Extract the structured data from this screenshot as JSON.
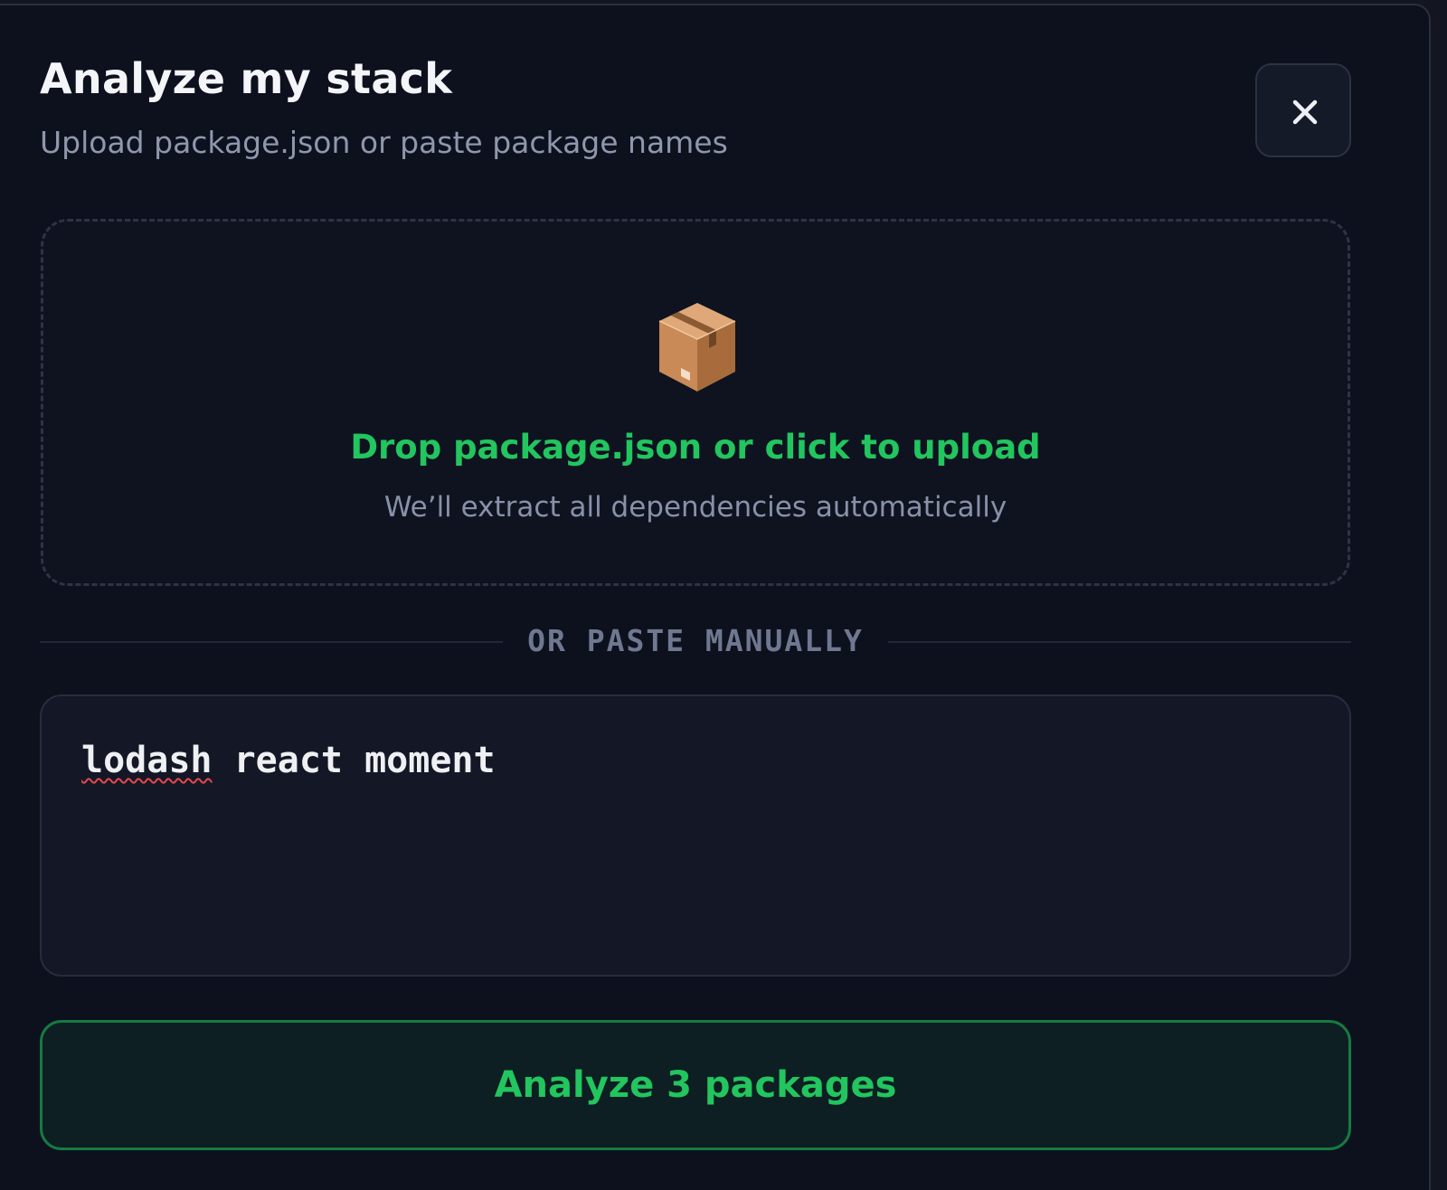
{
  "modal": {
    "title": "Analyze my stack",
    "subtitle": "Upload package.json or paste package names",
    "close_icon": "close-icon"
  },
  "dropzone": {
    "icon": "package-box-icon",
    "title": "Drop package.json or click to upload",
    "hint": "We’ll extract all dependencies automatically"
  },
  "divider": {
    "label": "OR PASTE MANUALLY"
  },
  "manual_input": {
    "tokens": [
      "lodash",
      " react moment"
    ],
    "spellcheck_flagged": "lodash"
  },
  "action": {
    "label": "Analyze 3 packages"
  },
  "colors": {
    "accent": "#22c55e",
    "background": "#0d111d",
    "spellcheck": "#e5484d"
  }
}
